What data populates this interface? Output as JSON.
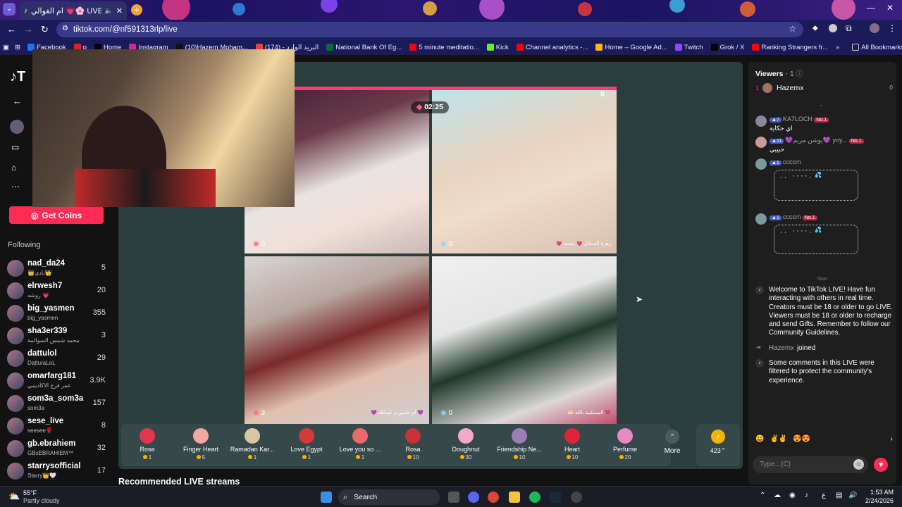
{
  "browser": {
    "tab_title": "ام الغوالي 💗🌸 UVE",
    "url": "tiktok.com/@nf591313rlp/live",
    "bookmarks": [
      "Facebook",
      "p",
      "Home",
      "Instagram",
      "(10)Hazem Moham...",
      "(174) - البريد الوارد",
      "National Bank Of Eg...",
      "5 minute meditatio...",
      "Kick",
      "Channel analytics -...",
      "Home – Google Ad...",
      "Twitch",
      "Grok / X",
      "Ranking Strangers fr..."
    ],
    "all_bookmarks": "All Bookmarks"
  },
  "sidebar": {
    "get_coins": "Get Coins",
    "following_label": "Following",
    "following": [
      {
        "name": "nad_da24",
        "sub": "👑نادي👑",
        "count": "5"
      },
      {
        "name": "elrwesh7",
        "sub": "روشه 💗",
        "count": "20"
      },
      {
        "name": "big_yasmen",
        "sub": "big_yasmen",
        "count": "355"
      },
      {
        "name": "sha3er339",
        "sub": "محمد شمس السوالمة",
        "count": "3"
      },
      {
        "name": "dattulol",
        "sub": "DatturaLoL",
        "count": "29"
      },
      {
        "name": "omarfarg181",
        "sub": "عمر فرج الاكاديمي",
        "count": "3.9K"
      },
      {
        "name": "som3a_som3a",
        "sub": "som3a",
        "count": "157"
      },
      {
        "name": "sese_live",
        "sub": "seesee🌹",
        "count": "8"
      },
      {
        "name": "gb.ebrahiem",
        "sub": "GBxEBRAHIEM™",
        "count": "32"
      },
      {
        "name": "starrysofficial",
        "sub": "Starry👑🤍",
        "count": "17"
      }
    ]
  },
  "stage": {
    "timer": "02:25",
    "score_top_right": "0",
    "cells": [
      {
        "score": "0",
        "label": ""
      },
      {
        "score": "0",
        "label": "💗 زهرة السنابل 💗 محمد"
      },
      {
        "score": "3",
        "label": "💜 ام حسين و عبدالله 💜"
      },
      {
        "score": "0",
        "label": "🤲🏻 المسكينة بالله 💗"
      }
    ],
    "recommended": "Recommended LIVE streams"
  },
  "gifts": [
    {
      "name": "Rose",
      "price": "1",
      "color": "#e0364f"
    },
    {
      "name": "Finger Heart",
      "price": "5",
      "color": "#f0a8a0"
    },
    {
      "name": "Ramadan Kar...",
      "price": "1",
      "color": "#d7c7a0"
    },
    {
      "name": "Love Egypt",
      "price": "1",
      "color": "#d23a3a"
    },
    {
      "name": "Love you so ...",
      "price": "1",
      "color": "#e86a6a"
    },
    {
      "name": "Rosa",
      "price": "10",
      "color": "#c8303a"
    },
    {
      "name": "Doughnut",
      "price": "30",
      "color": "#f2a9c9"
    },
    {
      "name": "Friendship Ne...",
      "price": "10",
      "color": "#9a7fb2"
    },
    {
      "name": "Heart",
      "price": "10",
      "color": "#e2223a"
    },
    {
      "name": "Perfume",
      "price": "20",
      "color": "#e68ac2"
    }
  ],
  "gift_more": "More",
  "coin_balance": "423",
  "chat": {
    "viewers_label": "Viewers",
    "viewers_count": "1",
    "top_viewer": "Hazemx",
    "top_viewer_score": "0",
    "messages": [
      {
        "user": "KA7LOCH",
        "level": "7",
        "no1": "No.1",
        "text": "اي حكاية"
      },
      {
        "user": "💜يوشن مريم💜 yoy...",
        "level": "11",
        "no1": "No.1",
        "text": "حبيبي"
      },
      {
        "user": "ccccm",
        "level": "1",
        "no1": "",
        "text": "⠀⡀⡀⠀⠄⠄⠄⠄⡀ 💦"
      },
      {
        "user": "ccccm",
        "level": "1",
        "no1": "No.1",
        "text": "⠀⡀⡀⠀⠄⠄⠄⠄⡀ 💦"
      }
    ],
    "now_label": "Now",
    "welcome": "Welcome to TikTok LIVE! Have fun interacting with others in real time. Creators must be 18 or older to go LIVE. Viewers must be 18 or older to recharge and send Gifts. Remember to follow our Community Guidelines.",
    "joined_user": "Hazemx",
    "joined_text": "joined",
    "filtered": "Some comments in this LIVE were filtered to protect the community's experience.",
    "input_placeholder": "Type...(C)"
  },
  "taskbar": {
    "weather_temp": "55°F",
    "weather_desc": "Partly cloudy",
    "search": "Search",
    "time": "1:53 AM",
    "date": "2/24/2026"
  }
}
